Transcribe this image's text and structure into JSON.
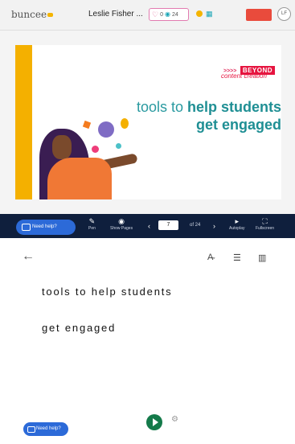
{
  "header": {
    "logo_text": "buncee",
    "author_name": "Leslie Fisher ...",
    "likes": "0",
    "views": "24",
    "grid_icon": "grid-icon",
    "action_button_label": "",
    "avatar_label": "LF"
  },
  "slide": {
    "arrows": ">>>>",
    "tag": "BEYOND",
    "subtag": "content creation",
    "headline_line1_plain": "tools to ",
    "headline_line1_bold": "help students",
    "headline_line2_bold": "get engaged"
  },
  "controls": {
    "help_label": "Need help?",
    "items": [
      {
        "icon": "pen-icon",
        "label": "Pen"
      },
      {
        "icon": "eye-icon",
        "label": "Show Pages"
      },
      {
        "icon": "play-icon",
        "label": "Autoplay"
      },
      {
        "icon": "fullscreen-icon",
        "label": "Fullscreen"
      }
    ],
    "current_page": "7",
    "page_total": "of 24"
  },
  "reader": {
    "line1": "tools to help students",
    "line2": "get engaged",
    "help_label": "Need help?"
  },
  "colors": {
    "accent_teal": "#2a9aa0",
    "brand_red": "#e6143f",
    "control_bar": "#0f1f3d",
    "help_blue": "#2c6ad8"
  }
}
